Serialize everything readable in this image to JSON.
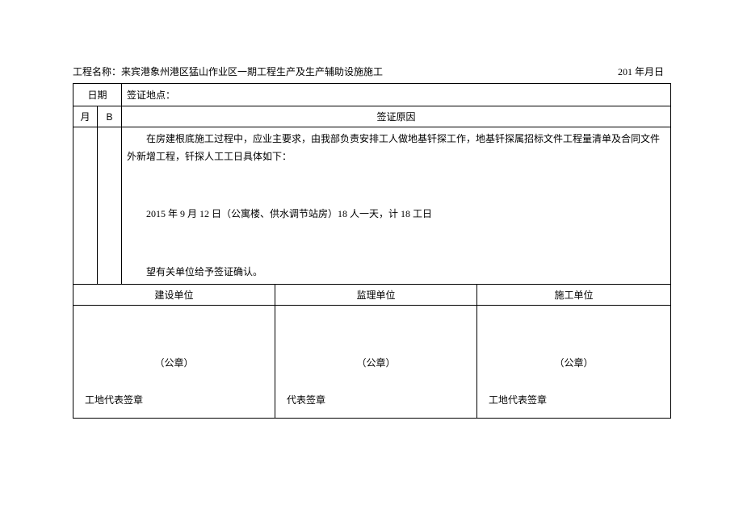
{
  "header": {
    "project_label": "工程名称：",
    "project_name": "来宾港象州港区猛山作业区一期工程生产及生产辅助设施施工",
    "date_right": "201 年月日"
  },
  "row_date": {
    "date_label": "日期",
    "location_label": "签证地点："
  },
  "row_mb": {
    "month_label": "月",
    "b_label": "B",
    "reason_header": "签证原因"
  },
  "content": {
    "para1": "在房建根底施工过程中，应业主要求，由我部负责安排工人做地基钎探工作，地基钎探属招标文件工程量清单及合同文件外新增工程，钎探人工工日具体如下：",
    "para2": "2015 年 9 月 12 日（公寓楼、供水调节站房）18 人一天，计 18 工日",
    "para3": "望有关单位给予签证确认。"
  },
  "units": {
    "col1": {
      "title": "建设单位",
      "seal": "（公章）",
      "rep": "工地代表签章"
    },
    "col2": {
      "title": "监理单位",
      "seal": "（公章）",
      "rep": "代表签章"
    },
    "col3": {
      "title": "施工单位",
      "seal": "（公章）",
      "rep": "工地代表签章"
    }
  }
}
